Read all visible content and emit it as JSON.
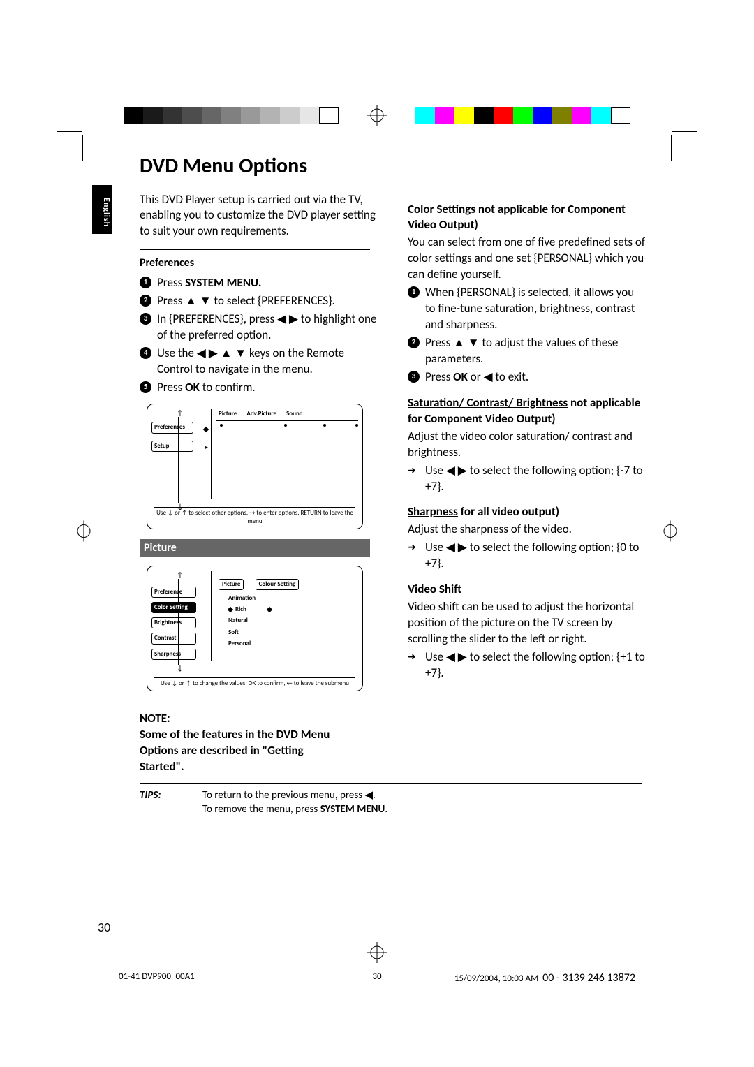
{
  "language_tab": "English",
  "title": "DVD Menu Options",
  "intro": "This DVD Player setup is carried out via the TV, enabling you to customize the DVD player setting to suit your own requirements.",
  "preferences": {
    "heading": "Preferences",
    "steps": [
      "Press SYSTEM MENU.",
      "Press ▲ ▼ to select {PREFERENCES}.",
      "In {PREFERENCES}, press ◀ ▶ to highlight one of the preferred option.",
      "Use the ◀ ▶ ▲ ▼ keys on the Remote Control to navigate in the menu.",
      "Press OK to confirm."
    ],
    "menu": {
      "left": [
        "Preferences",
        "Setup"
      ],
      "tabs": [
        "Picture",
        "Adv.Picture",
        "Sound"
      ],
      "hint": "Use ↓ or ↑ to select other options, → to enter options, RETURN to leave the menu"
    }
  },
  "picture": {
    "heading": "Picture",
    "menu": {
      "left": [
        "Preference",
        "Color Setting",
        "Brightness",
        "Contrast",
        "Sharpness"
      ],
      "top_box": "Picture",
      "right_title": "Colour Setting",
      "right_options": [
        "Animation",
        "Rich",
        "Natural",
        "Soft",
        "Personal"
      ],
      "hint": "Use ↓ or ↑ to change the values, OK to confirm, ← to leave the submenu"
    }
  },
  "note": "NOTE:\nSome of the features in the DVD Menu Options are described in \"Getting Started\".",
  "right_col": {
    "color": {
      "head": "Color Settings not applicable for Component Video Output)",
      "head_u": "Color Settings",
      "head_rest": " not applicable for Component Video Output)",
      "p1": "You can select from one of five predefined sets of color settings and one set {PERSONAL} which you can define yourself.",
      "s1": "When {PERSONAL} is selected, it allows you to fine-tune saturation, brightness, contrast and sharpness.",
      "s2": "Press ▲ ▼ to adjust the values of these parameters.",
      "s3": "Press OK or ◀ to exit."
    },
    "scb": {
      "head_u": "Saturation/ Contrast/ Brightness",
      "head_rest": " not applicable for Component Video Output)",
      "p1": "Adjust the video color saturation/ contrast and brightness.",
      "a1": "Use ◀ ▶ to select the following option; {-7 to +7}."
    },
    "sharp": {
      "head_u": "Sharpness",
      "head_rest": " for all video output)",
      "p1": "Adjust the sharpness of the video.",
      "a1": "Use ◀ ▶ to select the following option; {0 to +7}."
    },
    "vshift": {
      "head_u": "Video Shift",
      "p1": "Video shift can be used to adjust the horizontal position of the picture on the TV screen by scrolling the slider to the left or right.",
      "a1": "Use ◀ ▶ to select the following option; {+1 to +7}."
    }
  },
  "tips": {
    "label": "TIPS:",
    "l1": "To return to the previous menu, press ◀.",
    "l2": "To remove the menu, press SYSTEM MENU."
  },
  "page_num": "30",
  "footer": {
    "left": "01-41 DVP900_00A1",
    "center": "30",
    "right_a": "15/09/2004, 10:03 AM",
    "right_b": "00 - 3139 246 13872"
  },
  "reg_colors_gray": [
    "#000",
    "#1a1a1a",
    "#333",
    "#4d4d4d",
    "#666",
    "#808080",
    "#999",
    "#b3b3b3",
    "#ccc",
    "#e6e6e6",
    "#fff"
  ],
  "reg_colors_color": [
    "#00ffff",
    "#ff00ff",
    "#ffff00",
    "#000",
    "#ff0000",
    "#00ff00",
    "#0000ff",
    "#808000",
    "#ff00ff",
    "#00ffff",
    "#fff"
  ]
}
